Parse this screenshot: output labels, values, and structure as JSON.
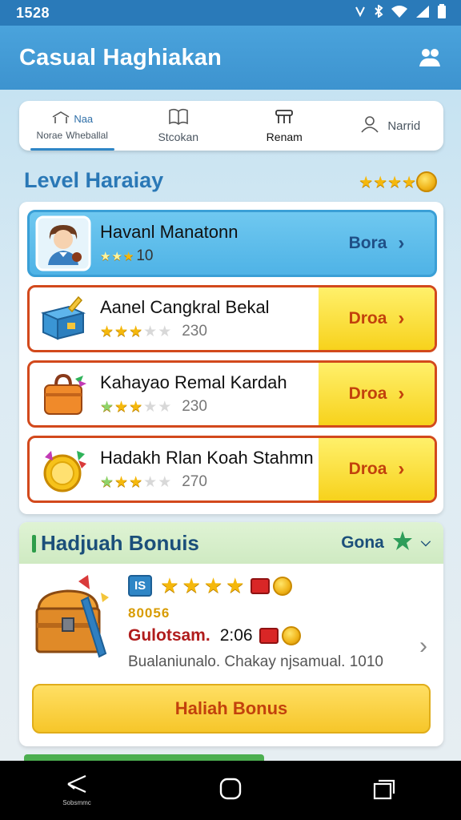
{
  "status_bar": {
    "time": "1528",
    "icons": [
      "nfc-icon",
      "bluetooth-icon",
      "wifi-icon",
      "signal-icon",
      "battery-icon"
    ]
  },
  "header": {
    "title": "Casual Haghiakan",
    "right_icon": "users-icon"
  },
  "tabs": [
    {
      "line1": "Naa",
      "line2a": "Norae",
      "line2b": "Wheballal",
      "icon": "home-icon",
      "active": true
    },
    {
      "label": "Stcokan",
      "icon": "book-icon"
    },
    {
      "label": "Renam",
      "icon": "bench-icon"
    },
    {
      "label": "Narrid",
      "icon": "person-icon"
    }
  ],
  "section": {
    "title": "Level Haraiay",
    "rating_stars": 4
  },
  "levels": [
    {
      "name": "Havanl Manatonn",
      "stars": 3,
      "score": "10",
      "action": "Bora",
      "style": "highlight",
      "thumb": "avatar-icon"
    },
    {
      "name": "Aanel Cangkral Bekal",
      "stars": 3,
      "stars_total": 5,
      "score": "230",
      "action": "Droa",
      "style": "normal",
      "thumb": "blue-chest-icon"
    },
    {
      "name": "Kahayao Remal Kardah",
      "stars": 3,
      "stars_total": 5,
      "score": "230",
      "action": "Droa",
      "style": "normal",
      "thumb": "orange-bag-icon"
    },
    {
      "name": "Hadakh Rlan Koah Stahmn",
      "stars": 3,
      "stars_total": 5,
      "score": "270",
      "action": "Droa",
      "style": "normal",
      "thumb": "gold-coin-icon"
    }
  ],
  "bonus": {
    "title": "Hadjuah Bonuis",
    "right_label": "Gona",
    "tag": "IS",
    "stars": 4,
    "code": "80056",
    "label": "Gulotsam.",
    "value": "2:06",
    "description": "Bualaniunalo. Chakay njsamual. 1010",
    "button": "Haliah Bonus"
  },
  "navbar": {
    "back_label": "Sobsmmc"
  },
  "colors": {
    "header_blue": "#3d93cf",
    "accent_yellow": "#f7d21c",
    "row_border_orange": "#d2491c",
    "title_blue": "#2a78b6"
  }
}
